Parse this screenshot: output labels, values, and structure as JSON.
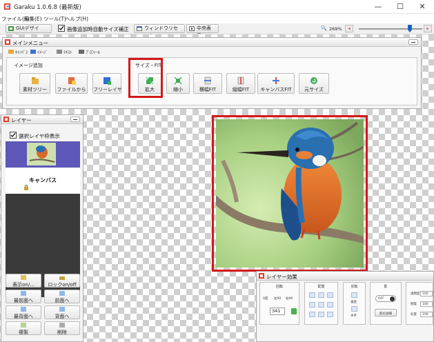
{
  "window": {
    "title": "Garaku 1.0.6.8 (最新版)",
    "controls": {
      "minimize": "—",
      "maximize": "☐",
      "close": "✕"
    }
  },
  "menubar": [
    "ファイル(F)",
    "編集(E)",
    "ツール(T)",
    "ヘルプ(H)"
  ],
  "toolbar": {
    "gui_design": "GUIデザイン...",
    "auto_resize": "画像追加時自動サイズ補正",
    "auto_resize_checked": true,
    "window_reset": "ウィンドウリセット",
    "center_view": "中央表示",
    "zoom_level": "269%"
  },
  "main_menu": {
    "title": "メインメニュー",
    "tabs": [
      "ｷｬﾝﾊﾞｽ",
      "ｲﾒｰｼﾞ",
      "ﾃｷｽﾄ",
      "ﾌﾟﾛﾌｨｰﾙ"
    ],
    "image_add": {
      "label": "イメージ追加",
      "buttons": [
        "素材ツリー",
        "ファイルから",
        "フリーレイヤ"
      ]
    },
    "size_fit": {
      "label": "サイズ・FIT",
      "buttons": [
        "拡大",
        "縮小",
        "横幅FIT",
        "縦幅FIT",
        "キャンバスFIT",
        "元サイズ"
      ]
    }
  },
  "layer_panel": {
    "title": "レイヤー",
    "show_frame": "選択レイヤ枠表示",
    "show_frame_checked": true,
    "canvas_label": "キャンバス",
    "buttons": [
      "表示on/...",
      "ロックon/off",
      "最前面へ",
      "前面へ",
      "最背面へ",
      "背面へ",
      "複製",
      "削除"
    ]
  },
  "effect_panel": {
    "title": "レイヤー効果",
    "rotate": {
      "label": "回転",
      "options": [
        "0度",
        "左90",
        "右90"
      ],
      "angle": "341"
    },
    "arrange": {
      "label": "配置"
    },
    "invert": {
      "label": "反転",
      "vertical": "垂直",
      "horizontal": "水平"
    },
    "shadow": {
      "label": "影",
      "toggle": "OFF",
      "detail": "影の詳細"
    },
    "color": {
      "labels": [
        "透明度",
        "明度",
        "彩度"
      ],
      "values": [
        "100",
        "100",
        "100"
      ]
    }
  },
  "colors": {
    "highlight": "#d51818",
    "accent": "#1a5fc4",
    "layer_selected": "#5c57b8"
  },
  "icons": [
    "garaku-logo-icon",
    "gui-design-icon",
    "window-reset-icon",
    "center-view-icon",
    "zoom-in-icon",
    "zoom-out-icon",
    "magnifier-icon"
  ]
}
